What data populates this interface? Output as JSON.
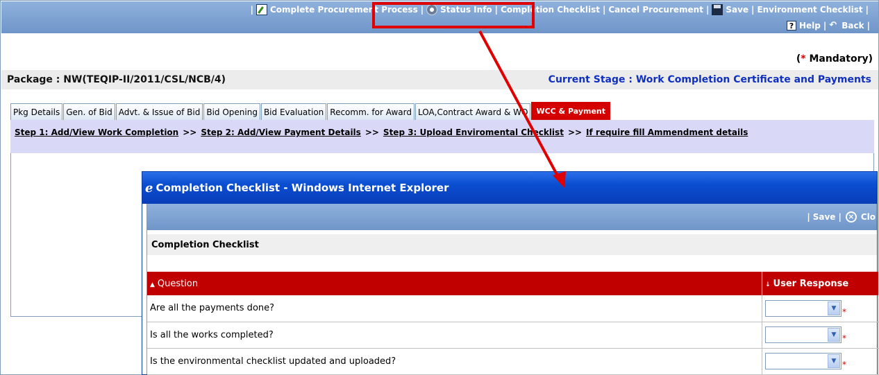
{
  "toolbar": {
    "complete_procurement": "Complete Procurement Process",
    "status_info": "Status Info",
    "completion_checklist": "Completion Checklist",
    "cancel_procurement": "Cancel Procurement",
    "save": "Save",
    "environment_checklist": "Environment Checklist",
    "help": "Help",
    "back": "Back"
  },
  "mandatory": {
    "star": "*",
    "label": "Mandatory"
  },
  "package": {
    "label": "Package : NW(TEQIP-II/2011/CSL/NCB/4)",
    "current_stage": "Current Stage : Work Completion Certificate and Payments"
  },
  "tabs": [
    {
      "label": "Pkg Details"
    },
    {
      "label": "Gen. of Bid"
    },
    {
      "label": "Advt. & Issue of Bid"
    },
    {
      "label": "Bid Opening"
    },
    {
      "label": "Bid Evaluation"
    },
    {
      "label": "Recomm. for Award"
    },
    {
      "label": "LOA,Contract Award & WO"
    },
    {
      "label": "WCC & Payment"
    }
  ],
  "steps": {
    "step1": "Step 1: Add/View Work Completion",
    "step2": "Step 2: Add/View Payment Details",
    "step3": "Step 3: Upload Enviromental Checklist",
    "step4": "If require fill Ammendment details",
    "separator": ">>"
  },
  "popup": {
    "title": "Completion Checklist - Windows Internet Explorer",
    "toolbar": {
      "save": "Save",
      "close": "Clo"
    },
    "section_title": "Completion Checklist",
    "columns": {
      "question": "Question",
      "user_response": "User Response"
    },
    "questions": [
      {
        "text": "Are all the payments done?"
      },
      {
        "text": "Is all the works completed?"
      },
      {
        "text": "Is the environmental checklist updated and uploaded?"
      }
    ]
  },
  "colors": {
    "toolbar": "#7fa3d4",
    "highlight": "#e00000",
    "active_tab": "#d40000",
    "stage_text": "#1030c0",
    "table_header": "#c00000"
  }
}
